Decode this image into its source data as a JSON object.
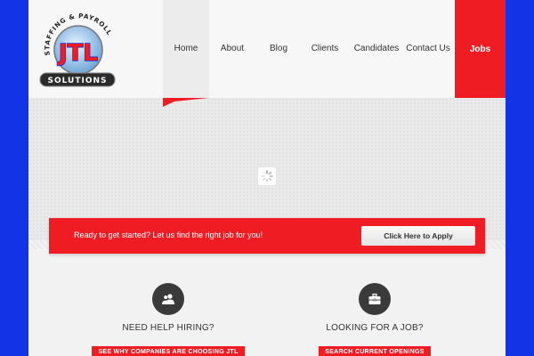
{
  "brand": {
    "logo_text": "JTL",
    "logo_arc_text": "STAFFING & PAYROLL",
    "logo_banner_text": "SOLUTIONS"
  },
  "nav": {
    "items": [
      {
        "label": "Home"
      },
      {
        "label": "About"
      },
      {
        "label": "Blog"
      },
      {
        "label": "Clients"
      },
      {
        "label": "Candidates"
      },
      {
        "label": "Contact Us"
      }
    ],
    "jobs_label": "Jobs"
  },
  "cta": {
    "text": "Ready to get started? Let us find the right job for you!",
    "button_label": "Click Here to Apply"
  },
  "features": [
    {
      "title": "NEED HELP HIRING?",
      "button_label": "SEE WHY COMPANIES ARE CHOOSING JTL",
      "icon": "users-icon"
    },
    {
      "title": "LOOKING FOR A JOB?",
      "button_label": "SEARCH CURRENT OPENINGS",
      "icon": "briefcase-icon"
    }
  ],
  "colors": {
    "accent": "#ef1c24",
    "side_background": "#1233e6",
    "icon_circle": "#3a3a3a"
  }
}
